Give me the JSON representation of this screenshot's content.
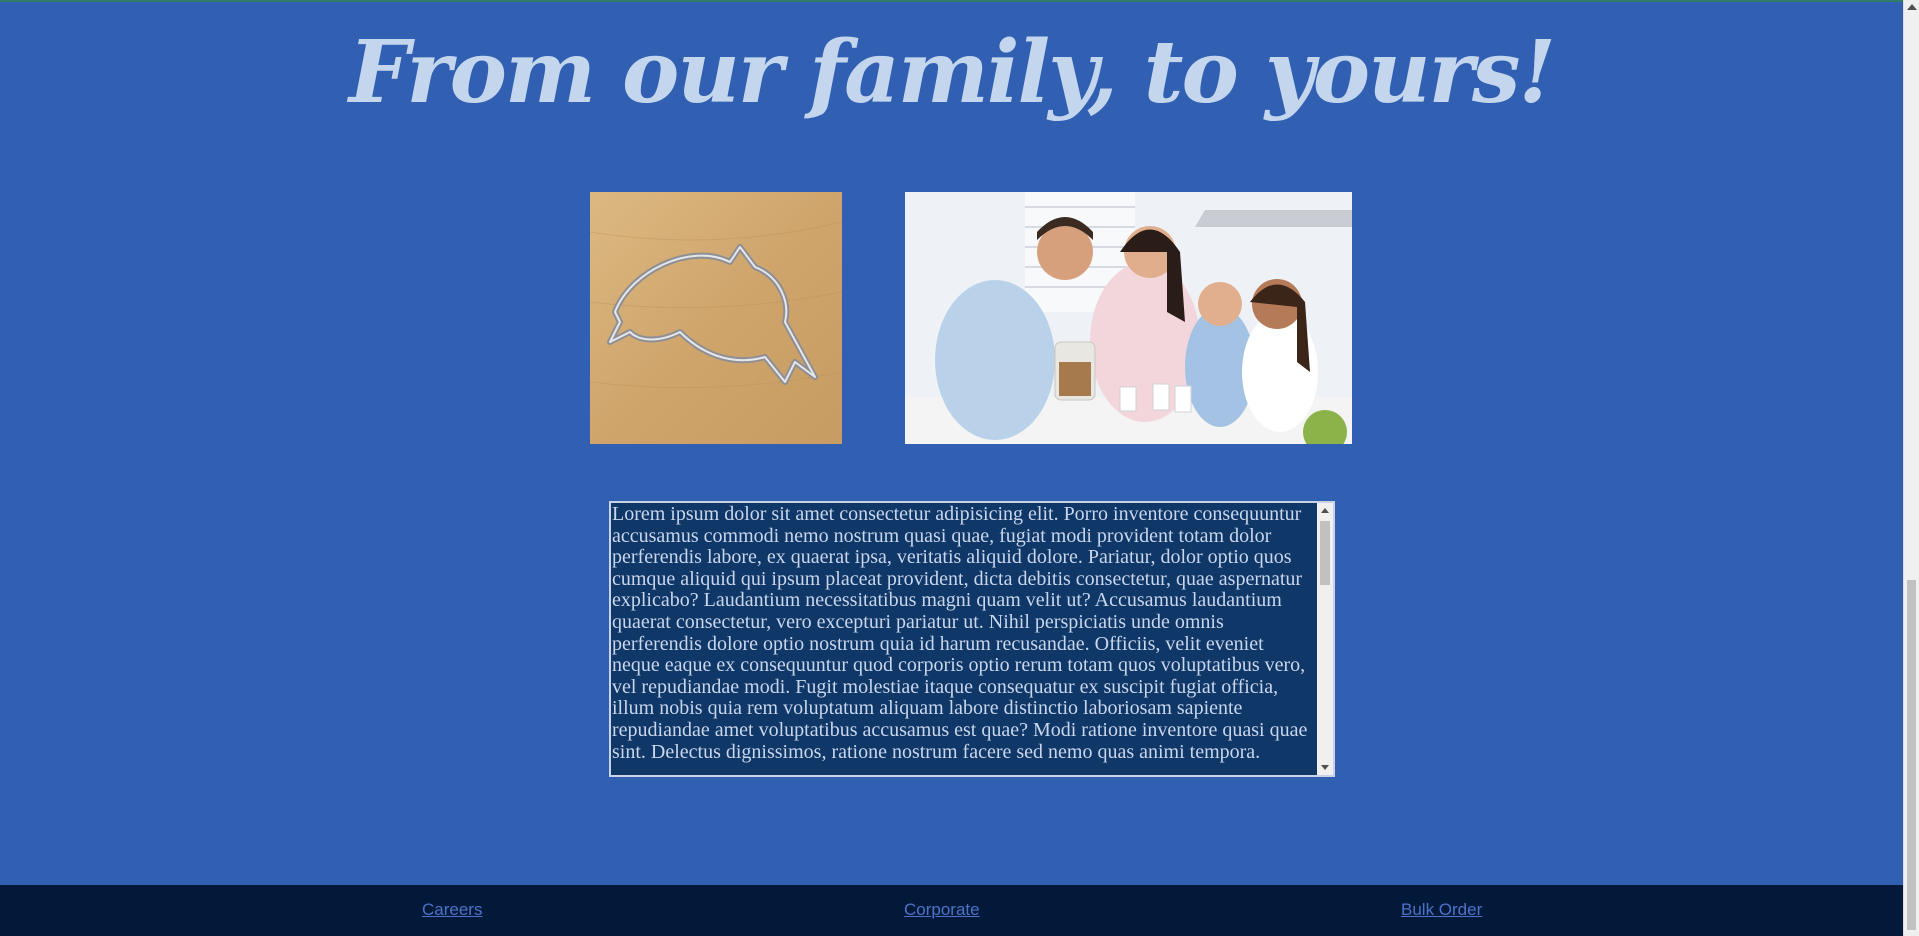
{
  "headline": "From our family, to yours!",
  "images": {
    "cookie_cutter": "fish-shaped cookie cutter on wooden board",
    "family": "family smiling at kitchen counter with cookie jar and glasses of milk"
  },
  "story_text": "Lorem ipsum dolor sit amet consectetur adipisicing elit. Porro inventore consequuntur accusamus commodi nemo nostrum quasi quae, fugiat modi provident totam dolor perferendis labore, ex quaerat ipsa, veritatis aliquid dolore. Pariatur, dolor optio quos cumque aliquid qui ipsum placeat provident, dicta debitis consectetur, quae aspernatur explicabo? Laudantium necessitatibus magni quam velit ut? Accusamus laudantium quaerat consectetur, vero excepturi pariatur ut. Nihil perspiciatis unde omnis perferendis dolore optio nostrum quia id harum recusandae. Officiis, velit eveniet neque eaque ex consequuntur quod corporis optio rerum totam quos voluptatibus vero, vel repudiandae modi. Fugit molestiae itaque consequatur ex suscipit fugiat officia, illum nobis quia rem voluptatum aliquam labore distinctio laboriosam sapiente repudiandae amet voluptatibus accusamus est quae? Modi ratione inventore quasi quae sint. Delectus dignissimos, ratione nostrum facere sed nemo quas animi tempora.",
  "footer": {
    "links": [
      "Careers",
      "Corporate",
      "Bulk Order"
    ]
  },
  "colors": {
    "page_background": "#3160b2",
    "headline": "#c4d5ee",
    "text_box_background": "#0f3768",
    "footer_background": "#02193a",
    "footer_link": "#4c73c9"
  }
}
